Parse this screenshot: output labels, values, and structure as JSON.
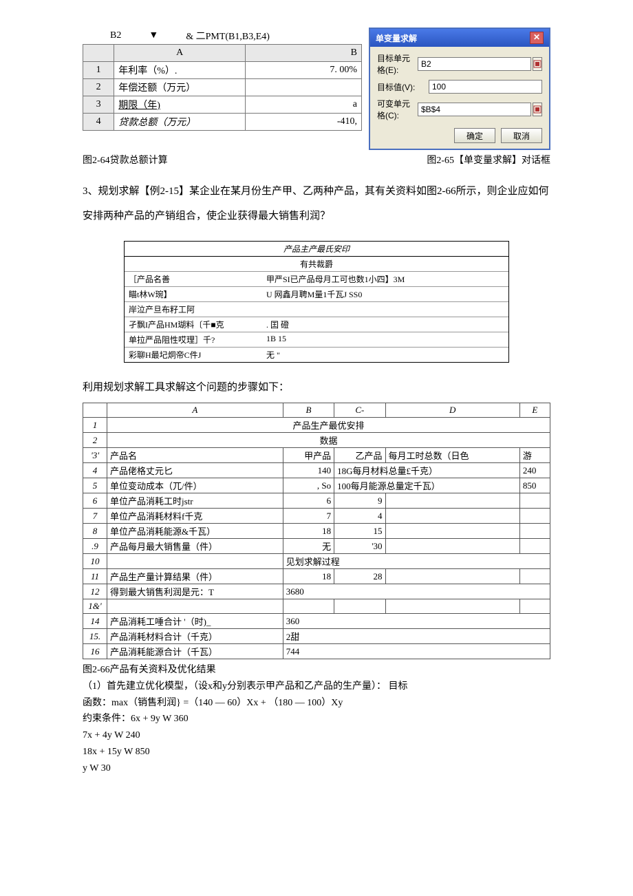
{
  "formula_bar": {
    "cell": "B2",
    "formula": "& 二PMT(B1,B3,E4)"
  },
  "spreadsheet1": {
    "headers": [
      "",
      "A",
      "B"
    ],
    "rows": [
      {
        "n": "1",
        "a": "年利率（%）.",
        "b": "7. 00%"
      },
      {
        "n": "2",
        "a": "年偿还额（万元）",
        "b": ""
      },
      {
        "n": "3",
        "a": "期限（年)",
        "b": "a"
      },
      {
        "n": "4",
        "a": "贷款总额（万元）",
        "b": "-410,"
      }
    ]
  },
  "caption1": "图2-64贷款总额计算",
  "caption2": "图2-65【单变量求解】对话框",
  "dialog": {
    "title": "单变量求解",
    "row1_label": "目标单元格(E):",
    "row1_value": "B2",
    "row2_label": "目标值(V):",
    "row2_value": "100",
    "row3_label": "可变单元格(C):",
    "row3_value": "$B$4",
    "ok": "确定",
    "cancel": "取消"
  },
  "para1": "3、规划求解【例2-15】某企业在某月份生产甲、乙两种产品，其有关资料如图2-66所示，则企业应如何安排两种产品的产销组合，使企业获得最大销售利润？",
  "blurry": {
    "head": "产品主产最氏安印",
    "sub": "有共裁爵",
    "r1l": "［产品名善",
    "r1r": "甲严SI已产品母月工可也数1小四】3M",
    "r2l": "瞄t林W琬】",
    "r2r": "U    网鑫月聘M量1千瓦J SS0",
    "r3l": "岸泣产旦布籽工阿",
    "r3r": "",
    "r4l": "孑飘I产品HM瑚料〔千■克",
    "r4r": ".  囯 磴",
    "r5l": " 单拉严品阻性哎理］千?",
    "r5r": "1B   15",
    "r6l": "彩聊H最圮炯帝C件J",
    "r6r": "无    \""
  },
  "para2": "利用规划求解工具求解这个问题的步骤如下：",
  "detail": {
    "headers": [
      "",
      "A",
      "B",
      "C-",
      "D",
      "E"
    ],
    "rows": [
      [
        "1",
        {
          "colspan": 5,
          "text": "产品生产最优安排"
        }
      ],
      [
        "2",
        {
          "colspan": 5,
          "text": "数据"
        }
      ],
      [
        "'3'",
        "产品名",
        "甲产品",
        "乙产品",
        "每月工时总数（日色",
        "游"
      ],
      [
        "4",
        "产品佬格丈元匕",
        "140",
        {
          "colspan": 2,
          "text": "18G每月材料总量£千克）",
          "align": "left"
        },
        "240"
      ],
      [
        "5",
        "单位变动成本（兀/件）",
        ", So",
        {
          "colspan": 2,
          "text": "100每月能源总量定千瓦）",
          "align": "left"
        },
        "850"
      ],
      [
        "6",
        "单位产品消耗工时jstr",
        "6",
        "9",
        "",
        ""
      ],
      [
        "7",
        "单位产品消耗材料f千克",
        "7",
        "4",
        "",
        ""
      ],
      [
        "8",
        "单位产品消耗能源&千瓦）",
        "18",
        "15",
        "",
        ""
      ],
      [
        ".9",
        "产品每月最大销售量（件）",
        "无",
        "'30",
        "",
        ""
      ],
      [
        "10",
        "",
        {
          "colspan": 4,
          "text": "见划求解过程",
          "align": "left"
        }
      ],
      [
        "11",
        "产品生产量计算结果（件）",
        "18",
        "28",
        "",
        ""
      ],
      [
        "12",
        "得到最大销售利润是元：T",
        {
          "colspan": 4,
          "text": "3680",
          "align": "left"
        }
      ],
      [
        "1&'",
        "",
        "",
        "",
        "",
        ""
      ],
      [
        "14",
        "产品消耗工唾合计 '（时)_",
        {
          "colspan": 4,
          "text": "360",
          "align": "left"
        }
      ],
      [
        "15.",
        "产品消耗材料合计（千克）",
        {
          "colspan": 4,
          "text": "2甜",
          "align": "left"
        }
      ],
      [
        "16",
        "产品消耗能源合计（千瓦）",
        {
          "colspan": 4,
          "text": "744",
          "align": "left"
        }
      ]
    ]
  },
  "caption3": "图2-66产品有关资料及优化结果",
  "post": [
    "（1）首先建立优化模型，（设x和y分别表示甲产品和乙产品的生产量）： 目标",
    "函数：max（销售利润} =（140 — 60）Xx + （180 — 100）Xy",
    "约束条件：6x + 9y W 360",
    "7x + 4y W 240",
    "18x + 15y W 850",
    "y W 30"
  ]
}
